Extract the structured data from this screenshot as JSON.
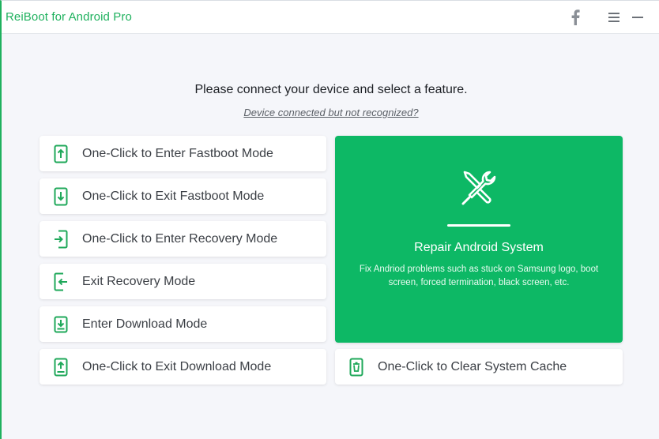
{
  "app": {
    "title": "ReiBoot for Android Pro"
  },
  "titlebar": {
    "icons": [
      "facebook-icon",
      "menu-icon",
      "minimize-icon",
      "close-icon"
    ]
  },
  "main": {
    "heading": "Please connect your device and select a feature.",
    "link": "Device connected but not recognized?"
  },
  "features": [
    {
      "label": "One-Click to Enter Fastboot Mode",
      "icon": "phone-arrow-up-icon"
    },
    {
      "label": "One-Click to Exit Fastboot Mode",
      "icon": "phone-arrow-down-icon"
    },
    {
      "label": "One-Click to Enter Recovery Mode",
      "icon": "phone-enter-icon"
    },
    {
      "label": "Exit Recovery Mode",
      "icon": "phone-exit-icon"
    },
    {
      "label": "Enter Download Mode",
      "icon": "tray-download-icon"
    },
    {
      "label": "One-Click to Exit Download Mode",
      "icon": "phone-upload-icon"
    }
  ],
  "repair": {
    "title": "Repair Android System",
    "description": "Fix Andriod problems such as stuck on Samsung logo, boot screen, forced termination, black screen, etc.",
    "icon": "tools-icon"
  },
  "cache": {
    "label": "One-Click to Clear System Cache",
    "icon": "trash-phone-icon"
  },
  "colors": {
    "accent": "#1fb15e",
    "repair_bg": "#0db865",
    "icon_green": "#1fa85a"
  }
}
